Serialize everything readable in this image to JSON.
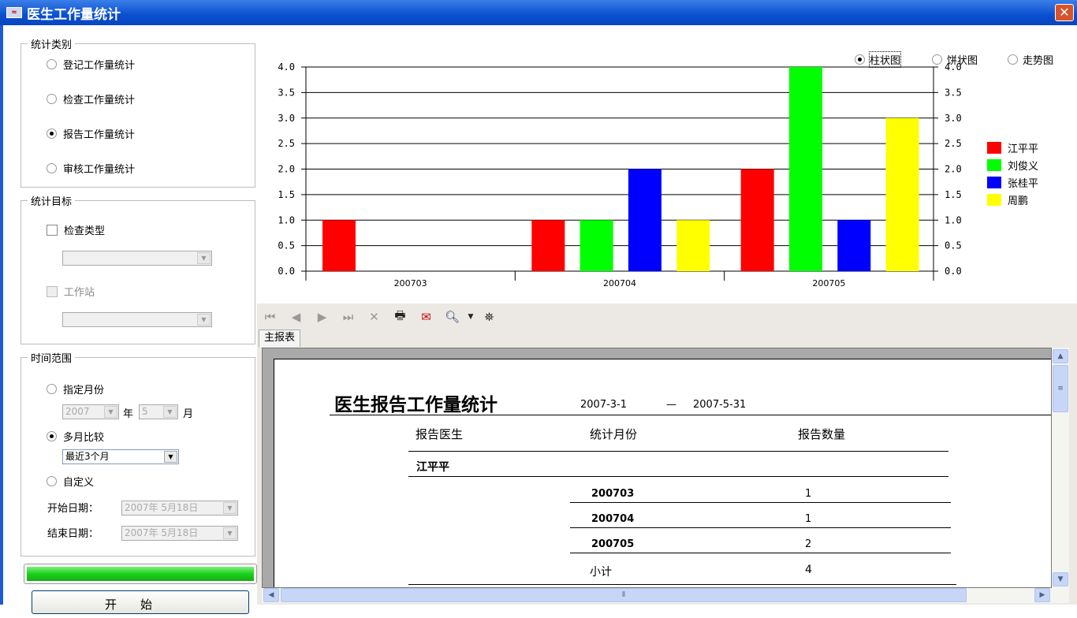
{
  "window": {
    "title": "医生工作量统计",
    "close": "✕"
  },
  "category": {
    "legend": "统计类别",
    "options": [
      {
        "label": "登记工作量统计",
        "selected": false
      },
      {
        "label": "检查工作量统计",
        "selected": false
      },
      {
        "label": "报告工作量统计",
        "selected": true
      },
      {
        "label": "审核工作量统计",
        "selected": false
      }
    ]
  },
  "target": {
    "legend": "统计目标",
    "check_type": "检查类型",
    "workstation": "工作站"
  },
  "time": {
    "legend": "时间范围",
    "specific_month": "指定月份",
    "year": "2007",
    "year_unit": "年",
    "month": "5",
    "month_unit": "月",
    "multi_month": "多月比较",
    "multi_value": "最近3个月",
    "custom": "自定义",
    "start_label": "开始日期：",
    "end_label": "结束日期：",
    "start_date": "2007年 5月18日",
    "end_date": "2007年 5月18日"
  },
  "progress": {
    "percent": 100
  },
  "start_button": "开始",
  "chart_types": [
    {
      "label": "柱状图",
      "selected": true
    },
    {
      "label": "饼状图",
      "selected": false
    },
    {
      "label": "走势图",
      "selected": false
    }
  ],
  "chart_data": {
    "type": "bar",
    "categories": [
      "200703",
      "200704",
      "200705"
    ],
    "series": [
      {
        "name": "江平平",
        "color": "#ff0000",
        "values": [
          1,
          1,
          2
        ]
      },
      {
        "name": "刘俊义",
        "color": "#00ff00",
        "values": [
          0,
          1,
          4
        ]
      },
      {
        "name": "张桂平",
        "color": "#0000ff",
        "values": [
          0,
          2,
          1
        ]
      },
      {
        "name": "周鹏",
        "color": "#ffff00",
        "values": [
          0,
          1,
          3
        ]
      }
    ],
    "ylim": [
      0,
      4
    ],
    "yticks": [
      "0.0",
      "0.5",
      "1.0",
      "1.5",
      "2.0",
      "2.5",
      "3.0",
      "3.5",
      "4.0"
    ],
    "legend": "right",
    "grid": true
  },
  "report": {
    "tab": "主报表",
    "title": "医生报告工作量统计",
    "date_from": "2007-3-1",
    "dash": "—",
    "date_to": "2007-5-31",
    "headers": [
      "报告医生",
      "统计月份",
      "报告数量"
    ],
    "doctor": "江平平",
    "rows": [
      {
        "month": "200703",
        "count": "1"
      },
      {
        "month": "200704",
        "count": "1"
      },
      {
        "month": "200705",
        "count": "2"
      }
    ],
    "subtotal_label": "小计",
    "subtotal": "4"
  }
}
